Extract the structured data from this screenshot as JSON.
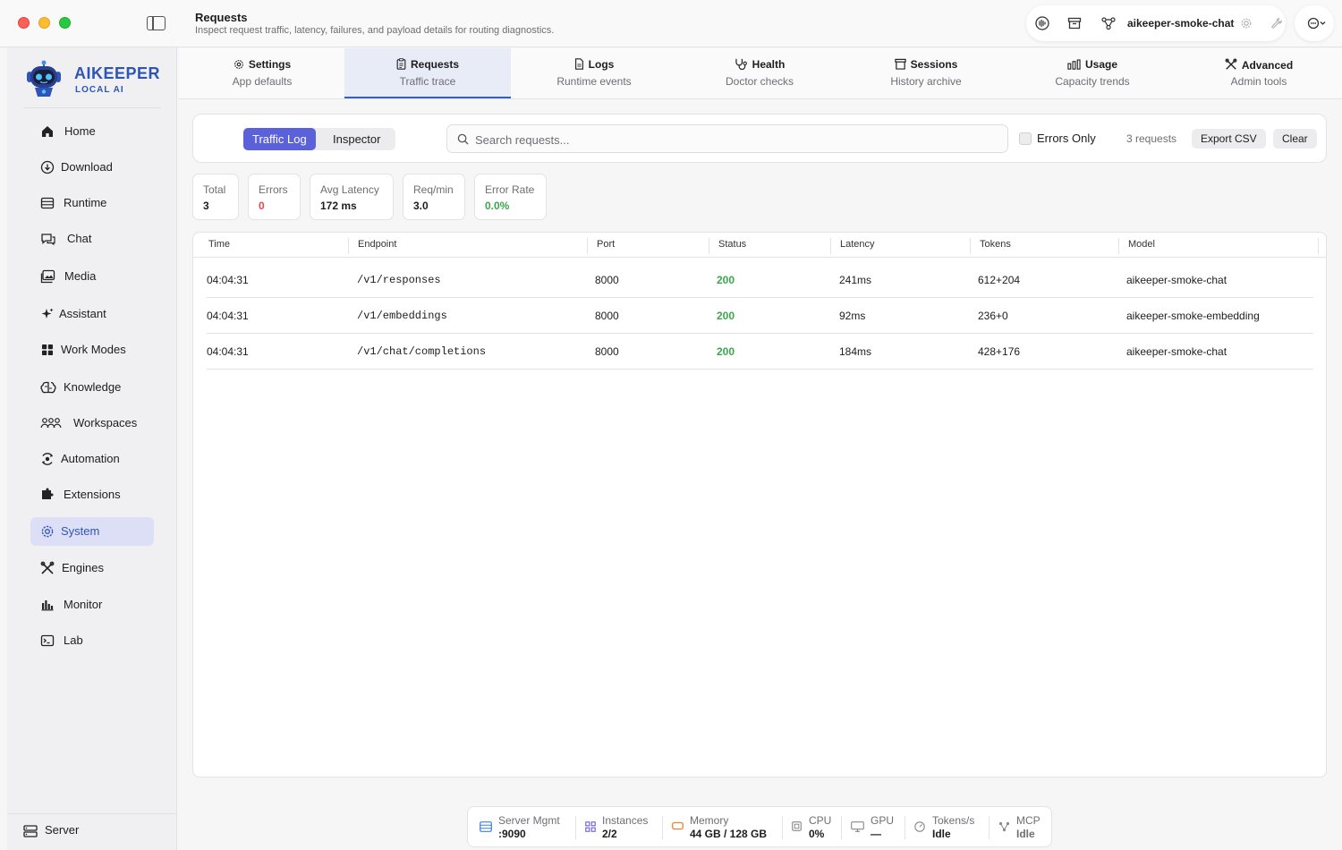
{
  "titlebar": {
    "title": "Requests",
    "subtitle": "Inspect request traffic, latency, failures, and payload details for routing diagnostics.",
    "model_name": "aikeeper-smoke-chat",
    "icons": [
      "waveform-icon",
      "archive-icon",
      "graph-icon",
      "gear-icon",
      "wrench-icon",
      "more-icon"
    ]
  },
  "brand": {
    "name": "AIKEEPER",
    "tagline": "LOCAL AI"
  },
  "sidebar": {
    "items": [
      {
        "label": "Home",
        "icon": "home-icon"
      },
      {
        "label": "Download",
        "icon": "download-icon"
      },
      {
        "label": "Runtime",
        "icon": "runtime-icon"
      },
      {
        "label": "Chat",
        "icon": "chat-icon"
      },
      {
        "label": "Media",
        "icon": "media-icon"
      },
      {
        "label": "Assistant",
        "icon": "sparkle-icon"
      },
      {
        "label": "Work Modes",
        "icon": "grid-icon"
      },
      {
        "label": "Knowledge",
        "icon": "brain-icon"
      },
      {
        "label": "Workspaces",
        "icon": "people-icon"
      },
      {
        "label": "Automation",
        "icon": "automation-icon"
      },
      {
        "label": "Extensions",
        "icon": "puzzle-icon"
      },
      {
        "label": "System",
        "icon": "gear-icon"
      },
      {
        "label": "Engines",
        "icon": "tools-icon"
      },
      {
        "label": "Monitor",
        "icon": "bars-icon"
      },
      {
        "label": "Lab",
        "icon": "terminal-icon"
      }
    ],
    "active": "System",
    "bottom_label": "Server"
  },
  "tabs": [
    {
      "label": "Settings",
      "sub": "App defaults"
    },
    {
      "label": "Requests",
      "sub": "Traffic trace"
    },
    {
      "label": "Logs",
      "sub": "Runtime events"
    },
    {
      "label": "Health",
      "sub": "Doctor checks"
    },
    {
      "label": "Sessions",
      "sub": "History archive"
    },
    {
      "label": "Usage",
      "sub": "Capacity trends"
    },
    {
      "label": "Advanced",
      "sub": "Admin tools"
    }
  ],
  "active_tab": "Requests",
  "filters": {
    "segments": [
      "Traffic Log",
      "Inspector"
    ],
    "active_segment": "Traffic Log",
    "search_placeholder": "Search requests...",
    "search_value": "",
    "errors_only_label": "Errors Only",
    "errors_only_checked": false,
    "request_count": "3 requests",
    "export_label": "Export CSV",
    "clear_label": "Clear"
  },
  "stats": [
    {
      "label": "Total",
      "value": "3"
    },
    {
      "label": "Errors",
      "value": "0"
    },
    {
      "label": "Avg Latency",
      "value": "172 ms"
    },
    {
      "label": "Req/min",
      "value": "3.0"
    },
    {
      "label": "Error Rate",
      "value": "0.0%"
    }
  ],
  "table": {
    "columns": [
      "Time",
      "Endpoint",
      "Port",
      "Status",
      "Latency",
      "Tokens",
      "Model"
    ],
    "rows": [
      [
        "04:04:31",
        "/v1/responses",
        "8000",
        "200",
        "241ms",
        "612+204",
        "aikeeper-smoke-chat"
      ],
      [
        "04:04:31",
        "/v1/embeddings",
        "8000",
        "200",
        "92ms",
        "236+0",
        "aikeeper-smoke-embedding"
      ],
      [
        "04:04:31",
        "/v1/chat/completions",
        "8000",
        "200",
        "184ms",
        "428+176",
        "aikeeper-smoke-chat"
      ]
    ]
  },
  "statusbar": [
    {
      "label": "Server Mgmt",
      "value": ":9090",
      "icon": "server-icon"
    },
    {
      "label": "Instances",
      "value": "2/2",
      "icon": "grid-icon"
    },
    {
      "label": "Memory",
      "value": "44 GB / 128 GB",
      "icon": "memory-icon"
    },
    {
      "label": "CPU",
      "value": "0%",
      "icon": "cpu-icon"
    },
    {
      "label": "GPU",
      "value": "—",
      "icon": "gpu-icon"
    },
    {
      "label": "Tokens/s",
      "value": "Idle",
      "icon": "gauge-icon"
    },
    {
      "label": "MCP",
      "value": "Idle",
      "icon": "mcp-icon"
    }
  ],
  "colors": {
    "accent": "#5b62d9",
    "brand": "#2f54b8",
    "status_ok": "#3aa84a",
    "error_value": "#e5484d",
    "sidebar_active": "#dcdff6"
  }
}
